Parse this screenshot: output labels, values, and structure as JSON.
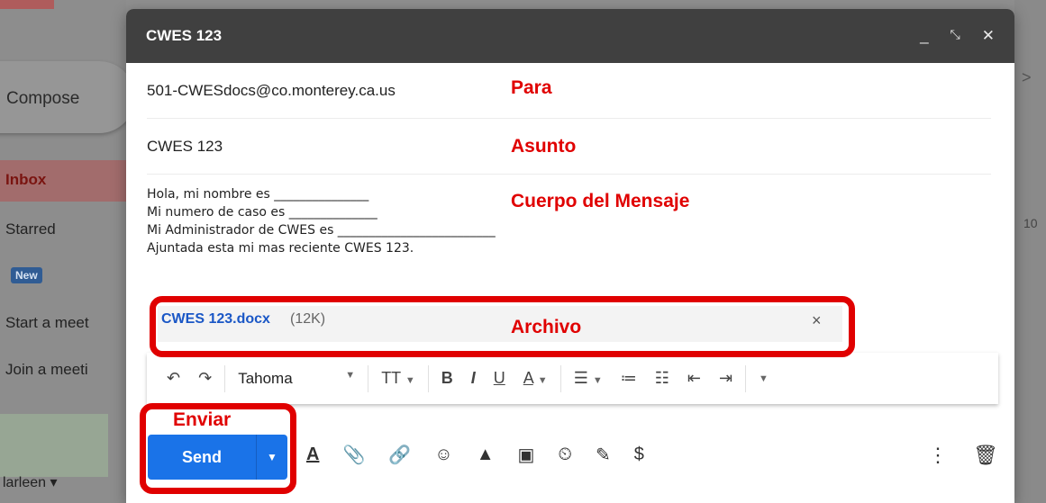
{
  "background": {
    "compose_label": "Compose",
    "nav": {
      "inbox": "Inbox",
      "starred": "Starred",
      "new_badge": "New",
      "start_meeting": "Start a meet",
      "join_meeting": "Join a meeti"
    },
    "user": "larleen ▾",
    "right_chevron": ">",
    "right_num": "10"
  },
  "compose": {
    "title": "CWES 123",
    "window_icons": [
      "minimize-icon",
      "exit-fullscreen-icon",
      "close-icon"
    ],
    "to": "501-CWESdocs@co.monterey.ca.us",
    "subject": "CWES 123",
    "body_lines": [
      "Hola, mi nombre es _______________",
      "Mi numero de caso es ______________",
      "Mi Administrador de CWES es _________________________",
      "Ajuntada esta mi mas reciente CWES 123."
    ],
    "attachment": {
      "name": "CWES 123.docx",
      "size": "(12K)",
      "close": "×"
    },
    "toolbar": {
      "font": "Tahoma",
      "bold": "B",
      "italic": "I",
      "underline": "U",
      "text_color": "A"
    },
    "send_label": "Send"
  },
  "annotations": {
    "para": "Para",
    "asunto": "Asunto",
    "cuerpo": "Cuerpo del Mensaje",
    "archivo": "Archivo",
    "enviar": "Enviar"
  },
  "colors": {
    "annotation": "#e00000",
    "send_button": "#1a73e8",
    "titlebar": "#404040",
    "attachment_link": "#1a57c6"
  }
}
